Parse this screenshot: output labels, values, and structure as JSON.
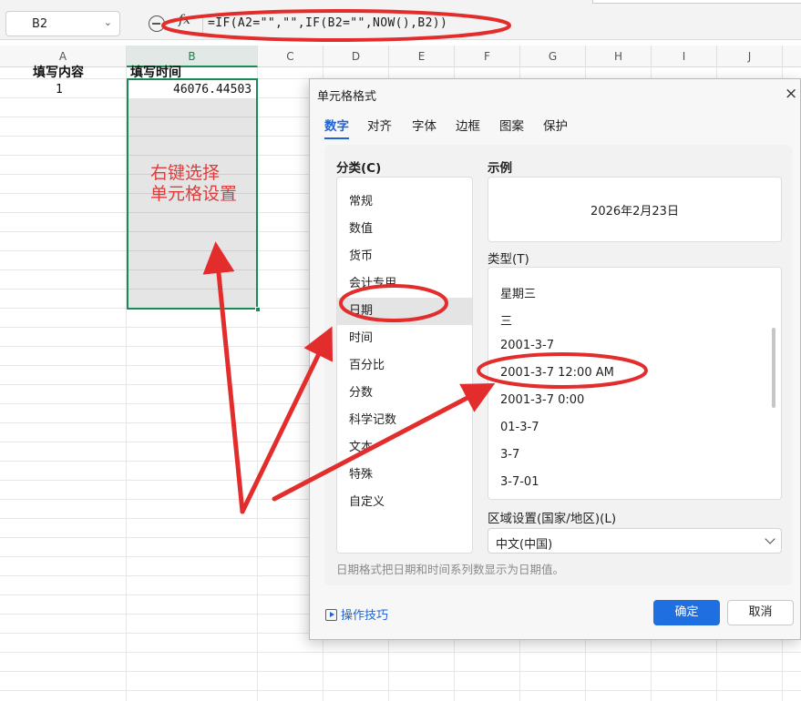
{
  "formula_bar": {
    "cell_reference": "B2",
    "fx_label": "fx",
    "formula": "=IF(A2=\"\",\"\",IF(B2=\"\",NOW(),B2))"
  },
  "sheet": {
    "columns": [
      "A",
      "B",
      "C",
      "D",
      "E",
      "F",
      "G",
      "H",
      "I",
      "J"
    ],
    "selected_column": "B",
    "header_row": {
      "a1": "填写内容",
      "b1": "填写时间"
    },
    "data_row": {
      "a2": "1",
      "b2": "46076.44503"
    },
    "annotation": [
      "右键选择",
      "单元格设置"
    ]
  },
  "dialog": {
    "title": "单元格格式",
    "close_glyph": "×",
    "tabs": [
      "数字",
      "对齐",
      "字体",
      "边框",
      "图案",
      "保护"
    ],
    "active_tab": "数字",
    "category_label": "分类(C)",
    "categories": [
      "常规",
      "数值",
      "货币",
      "会计专用",
      "日期",
      "时间",
      "百分比",
      "分数",
      "科学记数",
      "文本",
      "特殊",
      "自定义"
    ],
    "selected_category": "日期",
    "sample_label": "示例",
    "sample_value": "2026年2月23日",
    "type_label": "类型(T)",
    "types": [
      "星期三",
      "三",
      "2001-3-7",
      "2001-3-7 12:00 AM",
      "2001-3-7 0:00",
      "01-3-7",
      "3-7",
      "3-7-01"
    ],
    "locale_label": "区域设置(国家/地区)(L)",
    "locale_value": "中文(中国)",
    "description": "日期格式把日期和时间系列数显示为日期值。",
    "tips_link": "操作技巧",
    "ok_label": "确定",
    "cancel_label": "取消"
  },
  "colors": {
    "selection_green": "#1a8a55",
    "accent_blue": "#1f6fe0",
    "annotation_red": "#e03b3b"
  }
}
